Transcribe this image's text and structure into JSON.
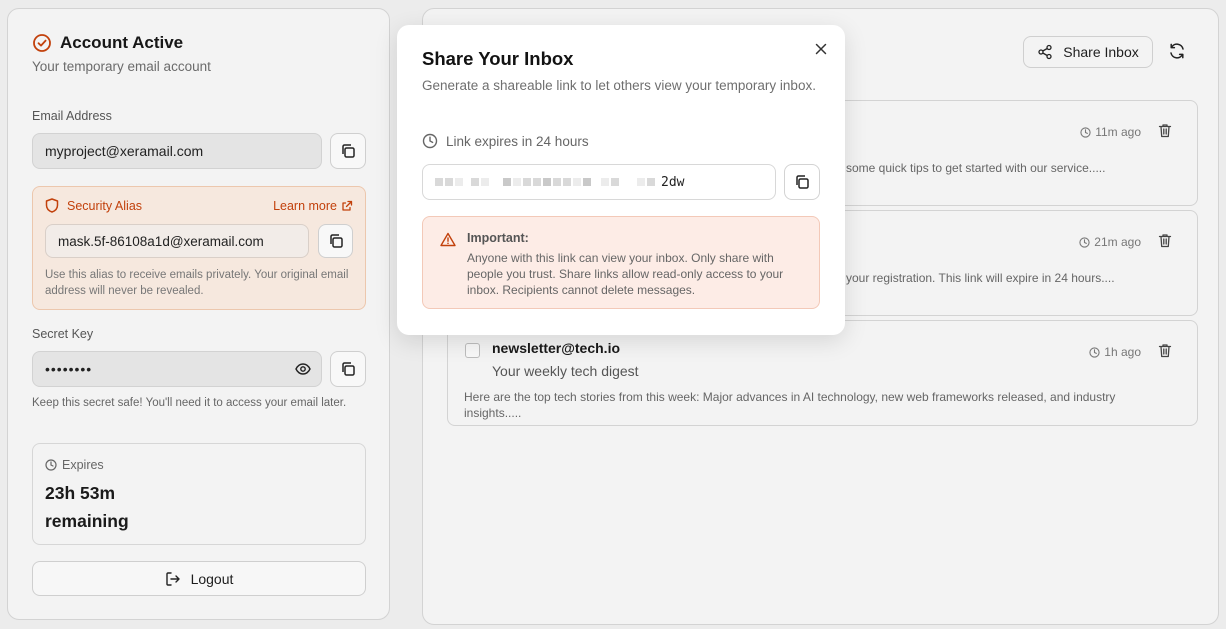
{
  "colors": {
    "accent_orange": "#c2410c",
    "alias_bg": "#f6e8de",
    "alert_bg": "#fdece6",
    "panel_bg": "#f3f3f3"
  },
  "account": {
    "title": "Account Active",
    "subtitle": "Your temporary email account",
    "title_icon": "check-circle-icon"
  },
  "email": {
    "label": "Email Address",
    "value": "myproject@xeramail.com"
  },
  "alias": {
    "label": "Security Alias",
    "learn_more": "Learn more",
    "value": "mask.5f-86108a1d@xeramail.com",
    "note": "Use this alias to receive emails privately. Your original email address will never be revealed."
  },
  "secret": {
    "label": "Secret Key",
    "masked_value": "••••••••",
    "note": "Keep this secret safe! You'll need it to access your email later."
  },
  "expires": {
    "label": "Expires",
    "value": "23h 53m remaining"
  },
  "logout": {
    "label": "Logout"
  },
  "inbox": {
    "share_label": "Share Inbox",
    "emails": [
      {
        "sender": "",
        "subject": "",
        "time": "11m ago",
        "preview": "some quick tips to get started with our service....."
      },
      {
        "sender": "",
        "subject": "",
        "time": "21m ago",
        "preview": "your registration. This link will expire in 24 hours...."
      },
      {
        "sender": "newsletter@tech.io",
        "subject": "Your weekly tech digest",
        "time": "1h ago",
        "preview": "Here are the top tech stories from this week: Major advances in AI technology, new web frameworks released, and industry insights....."
      }
    ]
  },
  "modal": {
    "title": "Share Your Inbox",
    "description": "Generate a shareable link to let others view your temporary inbox.",
    "expiry": "Link expires in 24 hours",
    "link_visible_suffix": "2dw",
    "alert_title": "Important:",
    "alert_text": "Anyone with this link can view your inbox. Only share with people you trust. Share links allow read-only access to your inbox. Recipients cannot delete messages."
  }
}
